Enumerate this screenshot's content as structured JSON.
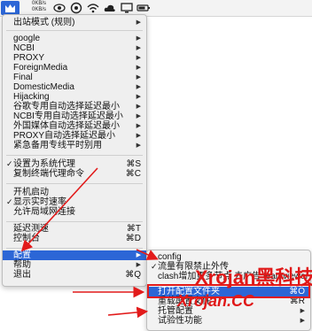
{
  "menubar": {
    "speed_up": "0KB/s",
    "speed_down": "0KB/s",
    "icons": [
      "clash-app-icon",
      "eye-icon",
      "circle-icon",
      "wifi-icon",
      "cloud-icon",
      "screen-icon",
      "battery-icon"
    ]
  },
  "main_menu": {
    "mode": "出站模式 (规则)",
    "groups": [
      "google",
      "NCBI",
      "PROXY",
      "ForeignMedia",
      "Final",
      "DomesticMedia",
      "Hijacking",
      "谷歌专用自动选择延迟最小",
      "NCBI专用自动选择延迟最小",
      "外国媒体自动选择延迟最小",
      "PROXY自动选择延迟最小",
      "紧急备用专线平时别用"
    ],
    "system_proxy": "设置为系统代理",
    "system_proxy_shortcut": "⌘S",
    "copy_terminal": "复制终端代理命令",
    "copy_terminal_shortcut": "⌘C",
    "startup": "开机启动",
    "realtime_speed": "显示实时速率",
    "allow_lan": "允许局域网连接",
    "latency_test": "延迟测速",
    "latency_test_shortcut": "⌘T",
    "dashboard": "控制台",
    "dashboard_shortcut": "⌘D",
    "config": "配置",
    "help": "帮助",
    "quit": "退出",
    "quit_shortcut": "⌘Q"
  },
  "sub_menu": {
    "config_name": "config",
    "rate_limit": "流量有限禁止外传",
    "clash_added": "clash增加更多节点 去广告 teamviewer",
    "open_folder": "打开配置文件夹",
    "open_folder_shortcut": "⌘O",
    "reload": "重载配置文件",
    "reload_shortcut": "⌘R",
    "hosted": "托管配置",
    "experimental": "试验性功能"
  },
  "annotation": {
    "watermark_text": "Xrojan黑科技",
    "watermark_url": "Xrojan.CC"
  },
  "colors": {
    "highlight": "#2c66d6",
    "annotation": "#e21b1b"
  }
}
